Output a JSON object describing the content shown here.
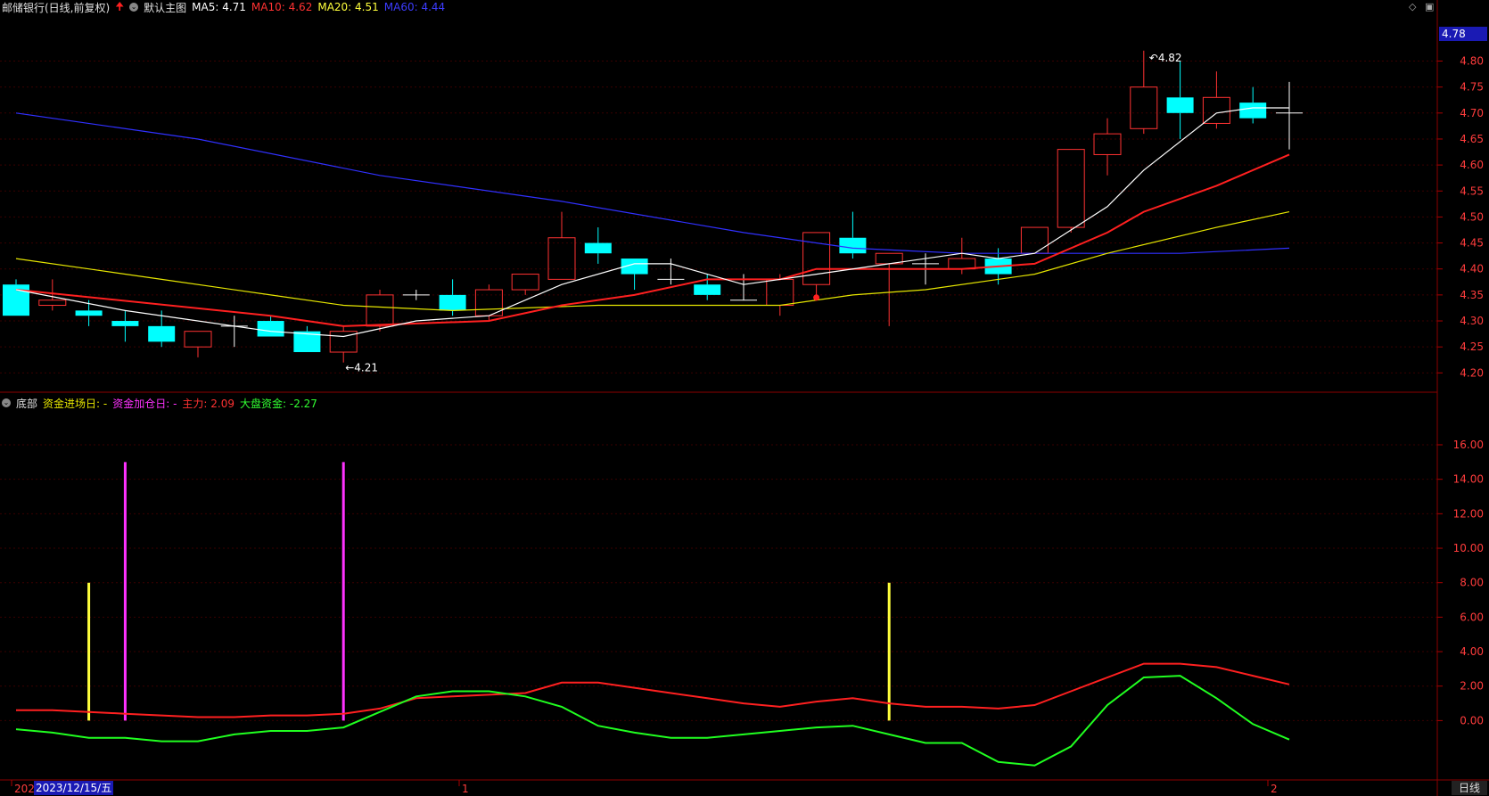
{
  "header": {
    "stock": "邮储银行(日线,前复权)",
    "template": "默认主图",
    "ma5": "MA5: 4.71",
    "ma10": "MA10: 4.62",
    "ma20": "MA20: 4.51",
    "ma60": "MA60: 4.44"
  },
  "sub_header": {
    "name": "底部",
    "entry": "资金进场日: -",
    "add": "资金加仓日: -",
    "main": "主力: 2.09",
    "market": "大盘资金: -2.27"
  },
  "price_axis": [
    "4.80",
    "4.75",
    "4.70",
    "4.65",
    "4.60",
    "4.55",
    "4.50",
    "4.45",
    "4.40",
    "4.35",
    "4.30",
    "4.25",
    "4.20"
  ],
  "price_tag": "4.78",
  "sub_axis": [
    "16.00",
    "14.00",
    "12.00",
    "10.00",
    "8.00",
    "6.00",
    "4.00",
    "2.00",
    "0.00"
  ],
  "x_labels": [
    "202",
    "1",
    "2"
  ],
  "date_box": "2023/12/15/五",
  "period": "日线",
  "annotations": {
    "high": "4.82",
    "low": "4.21"
  },
  "colors": {
    "up": "#ff3232",
    "down": "#00ffff",
    "ma5": "#ffffff",
    "ma10": "#ff2020",
    "ma20": "#e6e600",
    "ma60": "#3030ff"
  },
  "chart_data": {
    "type": "candlestick",
    "candles": [
      [
        4.37,
        4.31,
        4.38,
        4.31
      ],
      [
        4.33,
        4.34,
        4.38,
        4.32
      ],
      [
        4.32,
        4.31,
        4.34,
        4.29
      ],
      [
        4.3,
        4.29,
        4.32,
        4.26
      ],
      [
        4.29,
        4.26,
        4.32,
        4.25
      ],
      [
        4.25,
        4.28,
        4.28,
        4.23
      ],
      [
        4.29,
        4.29,
        4.31,
        4.25
      ],
      [
        4.3,
        4.27,
        4.31,
        4.27
      ],
      [
        4.28,
        4.24,
        4.29,
        4.24
      ],
      [
        4.24,
        4.28,
        4.29,
        4.22
      ],
      [
        4.29,
        4.35,
        4.36,
        4.28
      ],
      [
        4.35,
        4.35,
        4.36,
        4.34
      ],
      [
        4.35,
        4.32,
        4.38,
        4.31
      ],
      [
        4.31,
        4.36,
        4.37,
        4.3
      ],
      [
        4.36,
        4.39,
        4.39,
        4.35
      ],
      [
        4.38,
        4.46,
        4.51,
        4.38
      ],
      [
        4.45,
        4.43,
        4.48,
        4.41
      ],
      [
        4.42,
        4.39,
        4.42,
        4.36
      ],
      [
        4.38,
        4.38,
        4.42,
        4.37
      ],
      [
        4.37,
        4.35,
        4.39,
        4.34
      ],
      [
        4.34,
        4.34,
        4.39,
        4.34
      ],
      [
        4.33,
        4.38,
        4.39,
        4.31
      ],
      [
        4.37,
        4.47,
        4.47,
        4.35
      ],
      [
        4.46,
        4.43,
        4.51,
        4.42
      ],
      [
        4.41,
        4.43,
        4.43,
        4.29
      ],
      [
        4.41,
        4.41,
        4.43,
        4.37
      ],
      [
        4.4,
        4.42,
        4.46,
        4.39
      ],
      [
        4.42,
        4.39,
        4.44,
        4.37
      ],
      [
        4.43,
        4.48,
        4.48,
        4.43
      ],
      [
        4.48,
        4.63,
        4.63,
        4.47
      ],
      [
        4.62,
        4.66,
        4.69,
        4.58
      ],
      [
        4.67,
        4.75,
        4.82,
        4.66
      ],
      [
        4.73,
        4.7,
        4.8,
        4.65
      ],
      [
        4.68,
        4.73,
        4.78,
        4.67
      ],
      [
        4.72,
        4.69,
        4.75,
        4.68
      ],
      [
        4.7,
        4.7,
        4.76,
        4.63
      ]
    ],
    "ma5": [
      [
        0,
        4.36
      ],
      [
        3,
        4.32
      ],
      [
        7,
        4.28
      ],
      [
        9,
        4.27
      ],
      [
        11,
        4.3
      ],
      [
        13,
        4.31
      ],
      [
        15,
        4.37
      ],
      [
        17,
        4.41
      ],
      [
        18,
        4.41
      ],
      [
        20,
        4.37
      ],
      [
        22,
        4.39
      ],
      [
        24,
        4.41
      ],
      [
        26,
        4.43
      ],
      [
        27,
        4.42
      ],
      [
        28,
        4.43
      ],
      [
        30,
        4.52
      ],
      [
        31,
        4.59
      ],
      [
        33,
        4.7
      ],
      [
        34,
        4.71
      ],
      [
        35,
        4.71
      ]
    ],
    "ma10": [
      [
        0,
        4.36
      ],
      [
        7,
        4.31
      ],
      [
        9,
        4.29
      ],
      [
        13,
        4.3
      ],
      [
        15,
        4.33
      ],
      [
        17,
        4.35
      ],
      [
        19,
        4.38
      ],
      [
        21,
        4.38
      ],
      [
        22,
        4.4
      ],
      [
        24,
        4.4
      ],
      [
        26,
        4.4
      ],
      [
        28,
        4.41
      ],
      [
        30,
        4.47
      ],
      [
        31,
        4.51
      ],
      [
        33,
        4.56
      ],
      [
        35,
        4.62
      ]
    ],
    "ma20": [
      [
        0,
        4.42
      ],
      [
        2,
        4.4
      ],
      [
        4,
        4.38
      ],
      [
        7,
        4.35
      ],
      [
        9,
        4.33
      ],
      [
        12,
        4.32
      ],
      [
        16,
        4.33
      ],
      [
        19,
        4.33
      ],
      [
        21,
        4.33
      ],
      [
        23,
        4.35
      ],
      [
        25,
        4.36
      ],
      [
        28,
        4.39
      ],
      [
        30,
        4.43
      ],
      [
        33,
        4.48
      ],
      [
        35,
        4.51
      ]
    ],
    "ma60": [
      [
        0,
        4.7
      ],
      [
        5,
        4.65
      ],
      [
        10,
        4.58
      ],
      [
        15,
        4.53
      ],
      [
        20,
        4.47
      ],
      [
        23,
        4.44
      ],
      [
        26,
        4.43
      ],
      [
        29,
        4.43
      ],
      [
        32,
        4.43
      ],
      [
        35,
        4.44
      ]
    ],
    "main_force": [
      0.6,
      0.6,
      0.5,
      0.4,
      0.3,
      0.2,
      0.2,
      0.3,
      0.3,
      0.4,
      0.7,
      1.3,
      1.4,
      1.5,
      1.6,
      2.2,
      2.2,
      1.9,
      1.6,
      1.3,
      1.0,
      0.8,
      1.1,
      1.3,
      1.0,
      0.8,
      0.8,
      0.7,
      0.9,
      1.7,
      2.5,
      3.3,
      3.3,
      3.1,
      2.6,
      2.1
    ],
    "market_fund": [
      -0.5,
      -0.7,
      -1.0,
      -1.0,
      -1.2,
      -1.2,
      -0.8,
      -0.6,
      -0.6,
      -0.4,
      0.5,
      1.4,
      1.7,
      1.7,
      1.4,
      0.8,
      -0.3,
      -0.7,
      -1.0,
      -1.0,
      -0.8,
      -0.6,
      -0.4,
      -0.3,
      -0.8,
      -1.3,
      -1.3,
      -2.4,
      -2.6,
      -1.5,
      0.9,
      2.5,
      2.6,
      1.3,
      -0.2,
      -1.1
    ],
    "signal_bars": [
      {
        "i": 2,
        "value": 8,
        "color": "#ffff3c"
      },
      {
        "i": 3,
        "value": 15,
        "color": "#ff32ff"
      },
      {
        "i": 9,
        "value": 15,
        "color": "#ff32ff"
      },
      {
        "i": 24,
        "value": 8,
        "color": "#ffff3c"
      }
    ],
    "price_ylim": [
      4.18,
      4.83
    ],
    "sub_ylim": [
      -3.6,
      17.5
    ]
  }
}
